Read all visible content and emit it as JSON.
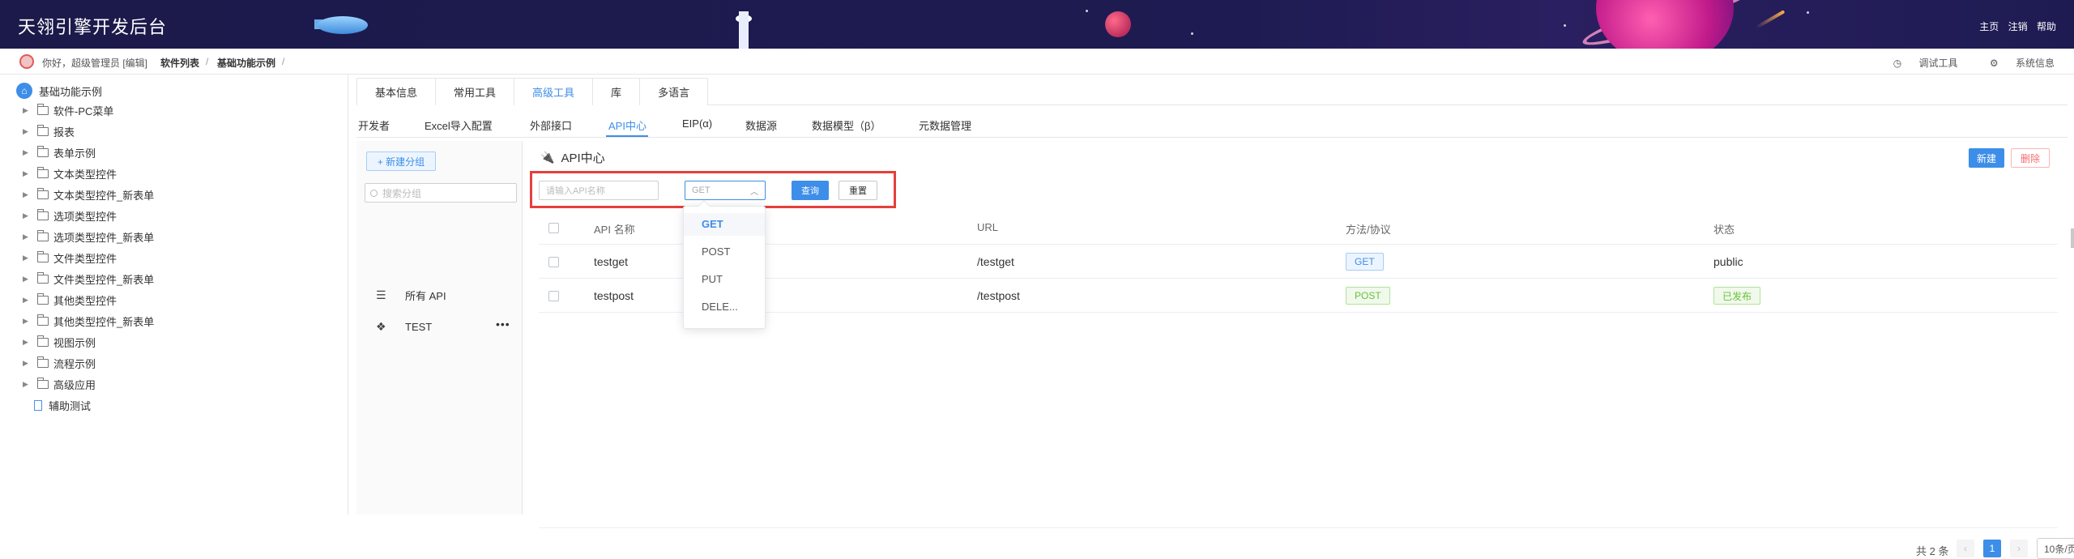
{
  "header": {
    "title": "天翎引擎开发后台",
    "links": [
      "主页",
      "注销",
      "帮助"
    ]
  },
  "breadcrumb": {
    "greeting": "你好，超级管理员 [编辑]",
    "items": [
      "软件列表",
      "基础功能示例"
    ],
    "separator": "/",
    "tools": [
      "调试工具",
      "系统信息"
    ]
  },
  "tree": {
    "root": "基础功能示例",
    "items": [
      "软件-PC菜单",
      "报表",
      "表单示例",
      "文本类型控件",
      "文本类型控件_新表单",
      "选项类型控件",
      "选项类型控件_新表单",
      "文件类型控件",
      "文件类型控件_新表单",
      "其他类型控件",
      "其他类型控件_新表单",
      "视图示例",
      "流程示例",
      "高级应用"
    ],
    "leaf": "辅助测试"
  },
  "tabs1": [
    "基本信息",
    "常用工具",
    "高级工具",
    "库",
    "多语言"
  ],
  "tabs1_active": "高级工具",
  "tabs2": [
    "开发者",
    "Excel导入配置",
    "外部接口",
    "API中心",
    "EIP(α)",
    "数据源",
    "数据模型（β）",
    "元数据管理"
  ],
  "tabs2_active": "API中心",
  "groups": {
    "new_label": "+ 新建分组",
    "search_placeholder": "搜索分组",
    "items": [
      {
        "icon": "list-icon",
        "label": "所有 API"
      },
      {
        "icon": "cluster-icon",
        "label": "TEST"
      }
    ],
    "more": "•••"
  },
  "content": {
    "title": "API中心",
    "new_button": "新建",
    "delete_button": "删除",
    "filter": {
      "name_placeholder": "请输入API名称",
      "method_value": "GET",
      "query_button": "查询",
      "reset_button": "重置"
    },
    "columns": [
      "API 名称",
      "URL",
      "方法/协议",
      "状态"
    ],
    "rows": [
      {
        "name": "testget",
        "url": "/testget",
        "method": "GET",
        "status": "public"
      },
      {
        "name": "testpost",
        "url": "/testpost",
        "method": "POST",
        "status": "已发布"
      }
    ],
    "method_options": [
      "GET",
      "POST",
      "PUT",
      "DELE..."
    ],
    "pagination": {
      "total": "共 2 条",
      "current": "1",
      "page_size": "10条/页"
    }
  },
  "colors": {
    "header_bg": "#1e1b52",
    "accent": "#3d8ee8",
    "danger": "#f56c6c",
    "success": "#67c23a",
    "highlight_box": "#e5403b"
  }
}
